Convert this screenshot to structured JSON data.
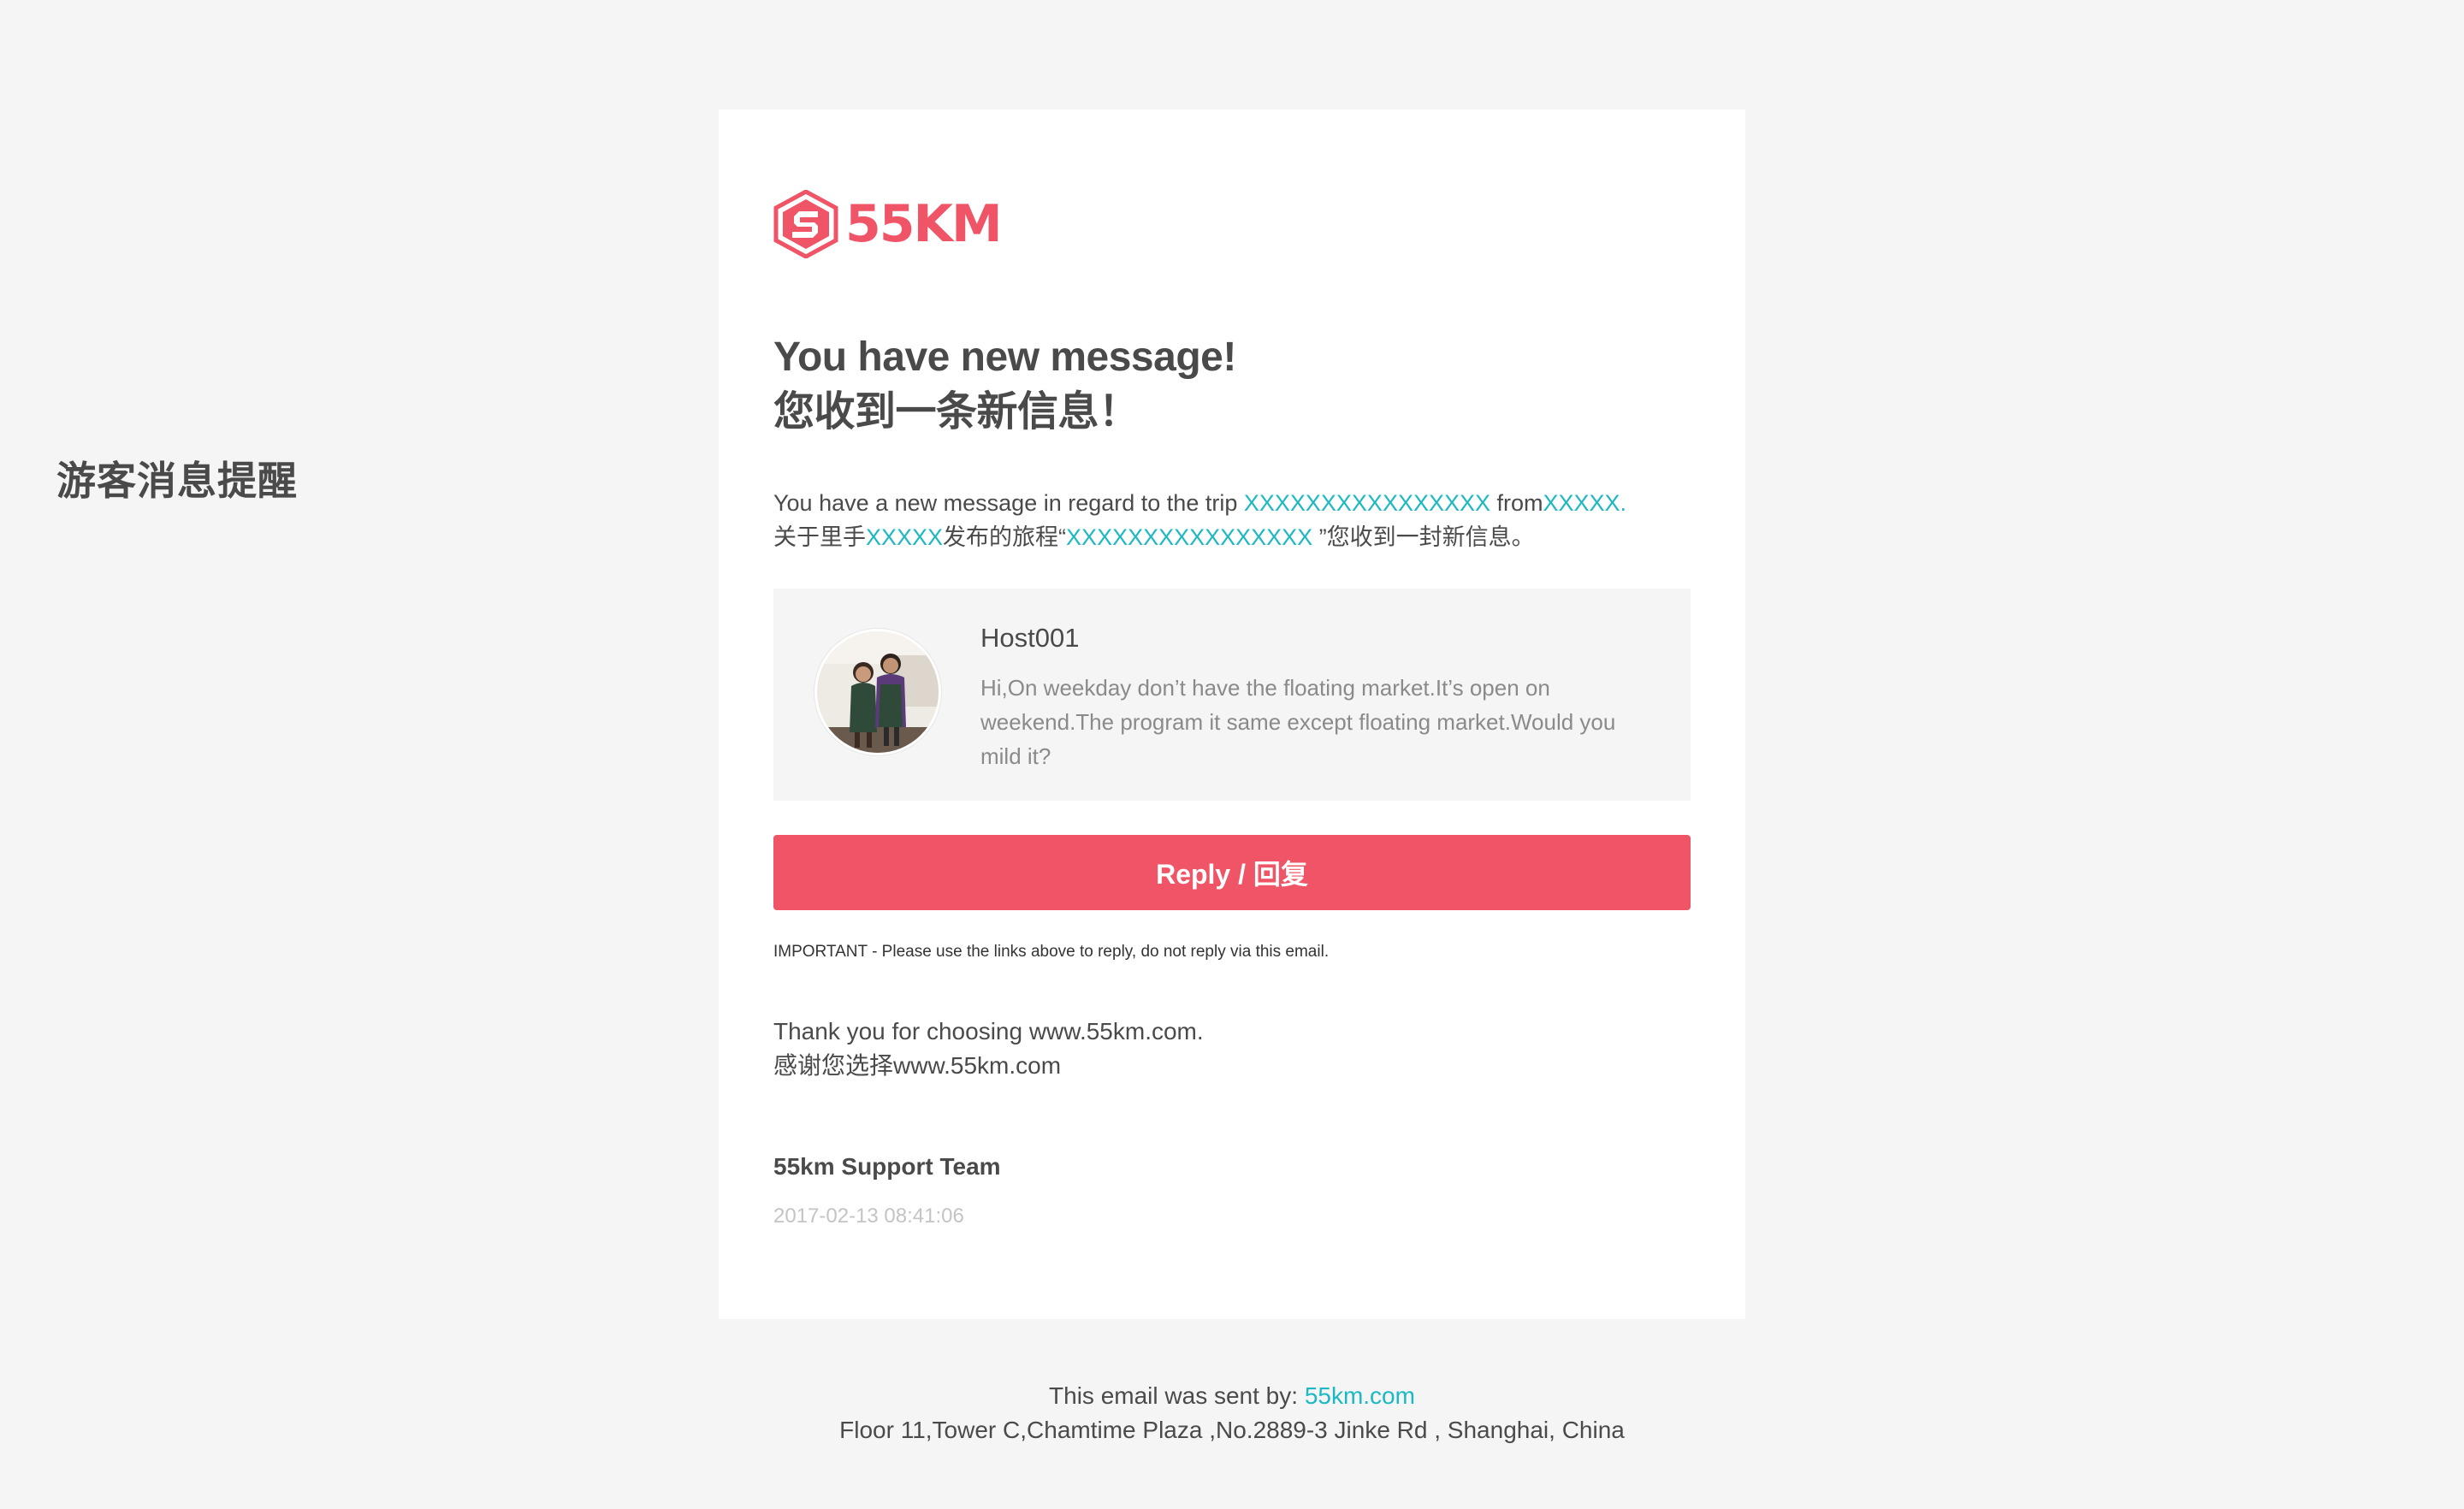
{
  "side_label": "游客消息提醒",
  "brand": {
    "wordmark": "55KM",
    "color": "#ef5566"
  },
  "headline": {
    "en": "You have new message!",
    "zh": "您收到一条新信息！"
  },
  "intro": {
    "en_prefix": "You have a new message in regard to the trip ",
    "en_trip": "XXXXXXXXXXXXXXXX",
    "en_from": " from",
    "en_host": "XXXXX.",
    "zh_prefix": "关于里手",
    "zh_host": "XXXXX",
    "zh_mid": "发布的旅程“",
    "zh_trip": "XXXXXXXXXXXXXXXX",
    "zh_suffix": " ”您收到一封新信息。"
  },
  "message": {
    "host_name": "Host001",
    "text": "Hi,On weekday don’t have the floating market.It’s open on weekend.The program it same except floating market.Would you mild it?"
  },
  "reply_button": "Reply / 回复",
  "important_note": "IMPORTANT - Please use the links above to reply, do not reply via this email.",
  "thanks": {
    "en": "Thank you for choosing www.55km.com.",
    "zh": "感谢您选择www.55km.com"
  },
  "signature": "55km Support Team",
  "timestamp": "2017-02-13 08:41:06",
  "footer": {
    "sent_by_label": "This email was sent by: ",
    "sent_by_link": "55km.com",
    "address": "Floor 11,Tower C,Chamtime Plaza ,No.2889-3 Jinke Rd , Shanghai, China"
  },
  "colors": {
    "accent": "#ef5566",
    "link": "#1cb8c4",
    "page_bg": "#f5f5f5"
  }
}
